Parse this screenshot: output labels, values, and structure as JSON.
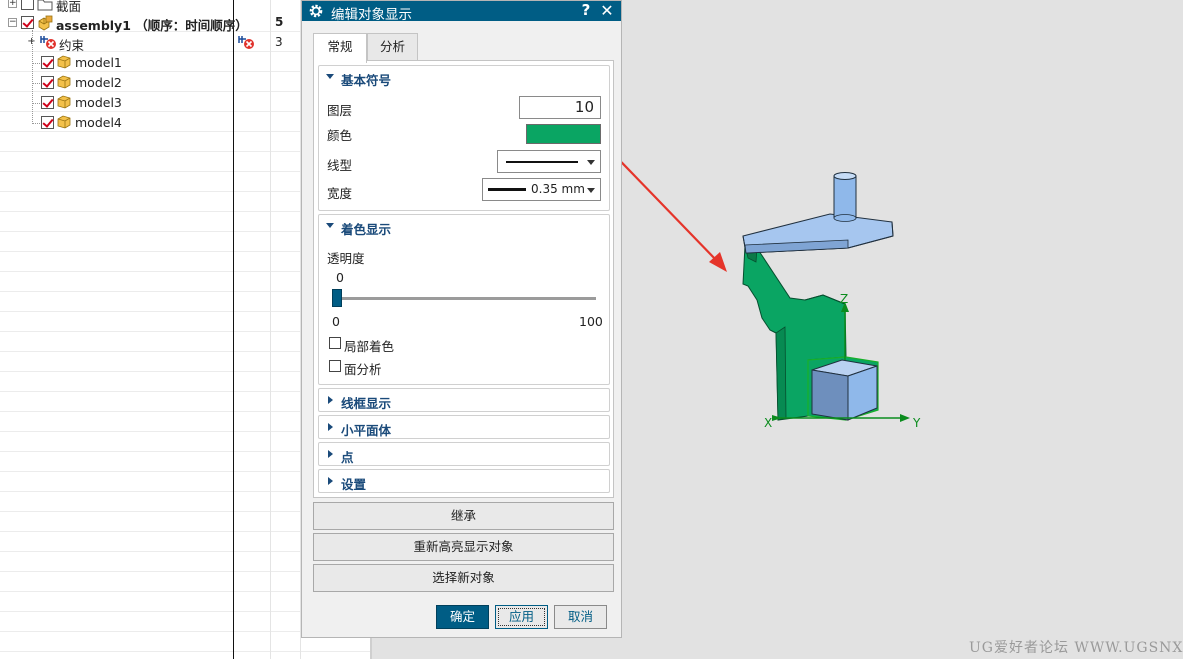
{
  "navigator": {
    "rows": [
      {
        "label": "截面",
        "count": ""
      },
      {
        "label": "assembly1 （顺序：时间顺序）",
        "count": "5"
      },
      {
        "label": "约束",
        "count": "3"
      },
      {
        "label": "model1",
        "count": ""
      },
      {
        "label": "model2",
        "count": ""
      },
      {
        "label": "model3",
        "count": ""
      },
      {
        "label": "model4",
        "count": ""
      }
    ]
  },
  "dialog": {
    "title": "编辑对象显示",
    "help_label": "?",
    "close_label": "✕",
    "tabs": [
      {
        "label": "常规",
        "active": true
      },
      {
        "label": "分析",
        "active": false
      }
    ],
    "basic": {
      "title": "基本符号",
      "layer_label": "图层",
      "layer_value": "10",
      "color_label": "颜色",
      "color_value": "#0aa563",
      "linetype_label": "线型",
      "width_label": "宽度",
      "width_value": "0.35 mm"
    },
    "shading": {
      "title": "着色显示",
      "transparency_label": "透明度",
      "transparency_value": "0",
      "slider_min": "0",
      "slider_max": "100",
      "partial_shading_label": "局部着色",
      "partial_shading_checked": false,
      "face_analysis_label": "面分析",
      "face_analysis_checked": false
    },
    "collapsed_groups": [
      {
        "label": "线框显示"
      },
      {
        "label": "小平面体"
      },
      {
        "label": "点"
      },
      {
        "label": "设置"
      }
    ],
    "buttons": {
      "inherit": "继承",
      "rehighlight": "重新高亮显示对象",
      "select_new": "选择新对象",
      "ok": "确定",
      "apply": "应用",
      "cancel": "取消"
    }
  },
  "viewport": {
    "axis_x": "X",
    "axis_y": "Y",
    "axis_z": "Z",
    "model_color": "#0aa563",
    "highlight_color": "#8fb8ea"
  },
  "watermark": "UG爱好者论坛 WWW.UGSNX.COM"
}
